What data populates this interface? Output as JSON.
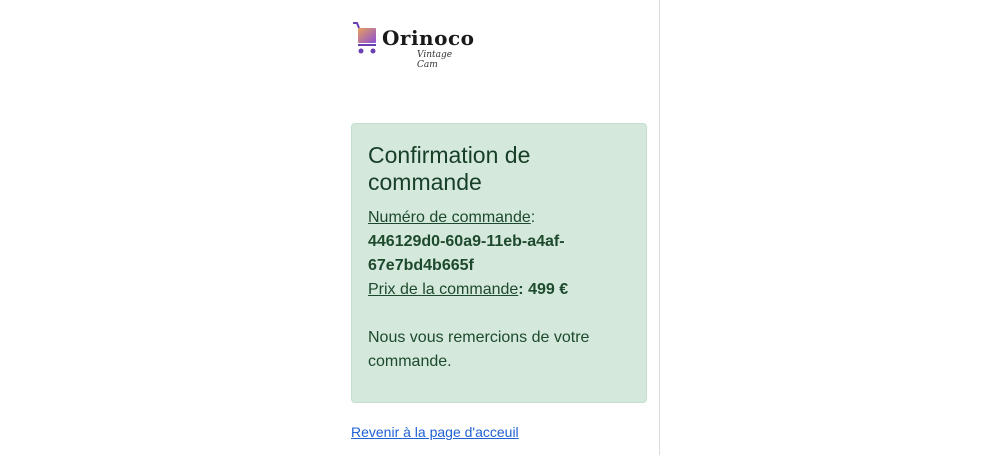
{
  "logo": {
    "name": "Orinoco",
    "tagline": "Vintage Cam"
  },
  "confirmation": {
    "title": "Confirmation de commande",
    "order_number_label": "Numéro de commande",
    "order_number": "446129d0-60a9-11eb-a4af-67e7bd4b665f",
    "price_label": "Prix de la commande",
    "price": "499 €",
    "thanks": "Nous vous remercions de votre commande."
  },
  "links": {
    "back_home": "Revenir à la page d'acceuil"
  },
  "colors": {
    "card_bg": "#d4e8dc",
    "card_text": "#1d4a2c",
    "link": "#1f62d6"
  }
}
